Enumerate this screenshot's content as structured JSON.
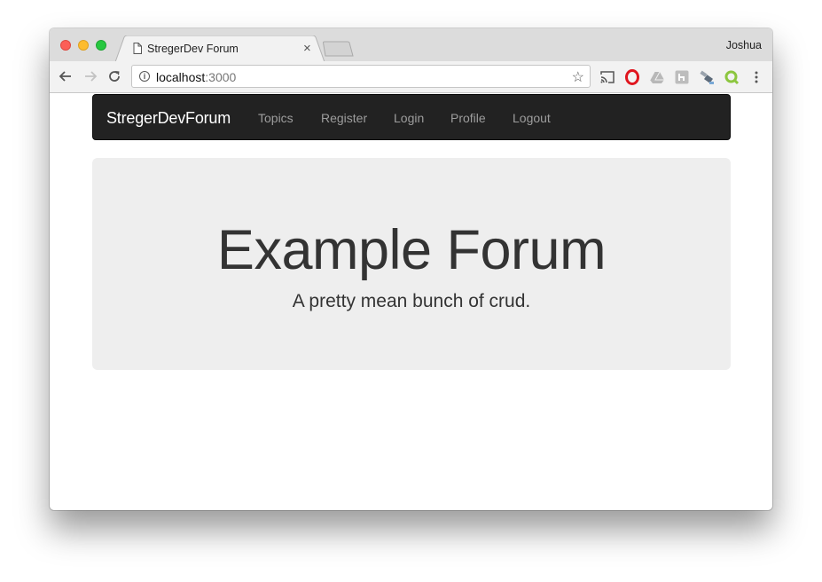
{
  "browser": {
    "tab_title": "StregerDev Forum",
    "tab_close": "×",
    "profile_name": "Joshua",
    "url_host": "localhost",
    "url_port": ":3000",
    "star": "☆",
    "info": "i",
    "extensions": [
      "cast-icon",
      "opera-icon",
      "drive-icon",
      "extension-icon",
      "satellite-icon",
      "q-icon",
      "more-menu-icon"
    ]
  },
  "navbar": {
    "brand": "StregerDevForum",
    "links": [
      "Topics",
      "Register",
      "Login",
      "Profile",
      "Logout"
    ]
  },
  "jumbotron": {
    "title": "Example Forum",
    "subtitle": "A pretty mean bunch of crud."
  },
  "colors": {
    "navbar_bg": "#222222",
    "navbar_link": "#9d9d9d",
    "jumbotron_bg": "#eeeeee",
    "text": "#333333"
  }
}
